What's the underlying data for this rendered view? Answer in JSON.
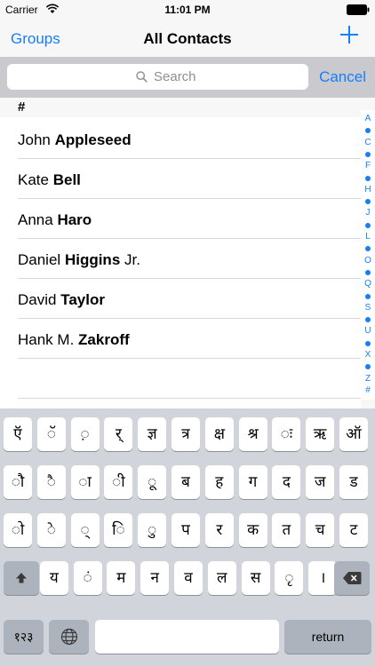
{
  "status_bar": {
    "carrier": "Carrier",
    "time": "11:01 PM"
  },
  "nav": {
    "left_button": "Groups",
    "title": "All Contacts",
    "right_icon": "plus-icon"
  },
  "search": {
    "placeholder": "Search",
    "cancel": "Cancel"
  },
  "section": {
    "header": "#"
  },
  "contacts": [
    {
      "first": "John",
      "last": "Appleseed",
      "suffix": ""
    },
    {
      "first": "Kate",
      "last": "Bell",
      "suffix": ""
    },
    {
      "first": "Anna",
      "last": "Haro",
      "suffix": ""
    },
    {
      "first": "Daniel",
      "last": "Higgins",
      "suffix": " Jr."
    },
    {
      "first": "David",
      "last": "Taylor",
      "suffix": ""
    },
    {
      "first": "Hank M.",
      "last": "Zakroff",
      "suffix": ""
    }
  ],
  "index": [
    "A",
    "•",
    "C",
    "•",
    "F",
    "•",
    "H",
    "•",
    "J",
    "•",
    "L",
    "•",
    "O",
    "•",
    "Q",
    "•",
    "S",
    "•",
    "U",
    "•",
    "X",
    "•",
    "Z",
    "#"
  ],
  "keyboard": {
    "row1": [
      "ऍ",
      "ॅ",
      "़",
      "र्",
      "ज्ञ",
      "त्र",
      "क्ष",
      "श्र",
      "ः",
      "ऋ",
      "ऑ"
    ],
    "row2": [
      "ौ",
      "ै",
      "ा",
      "ी",
      "ू",
      "ब",
      "ह",
      "ग",
      "द",
      "ज",
      "ड"
    ],
    "row3": [
      "ो",
      "े",
      "्",
      "ि",
      "ु",
      "प",
      "र",
      "क",
      "त",
      "च",
      "ट"
    ],
    "row4": [
      "य",
      "ं",
      "म",
      "न",
      "व",
      "ल",
      "स",
      "ृ",
      "।"
    ],
    "numbers_label": "१२३",
    "return_label": "return"
  },
  "colors": {
    "accent": "#157efb",
    "keyboard_bg": "#d1d5db"
  }
}
